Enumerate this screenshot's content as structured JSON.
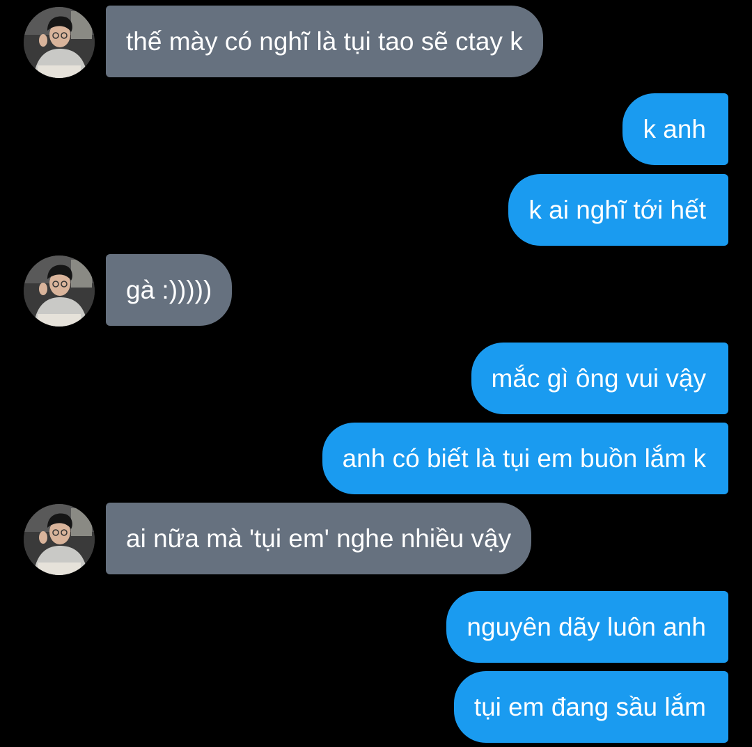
{
  "messages": [
    {
      "sender": "contact",
      "text": "thế mày có nghĩ là tụi tao sẽ ctay k"
    },
    {
      "sender": "me",
      "text": "k anh"
    },
    {
      "sender": "me",
      "text": "k ai nghĩ tới hết"
    },
    {
      "sender": "contact",
      "text": "gà :)))))"
    },
    {
      "sender": "me",
      "text": "mắc gì ông vui vậy"
    },
    {
      "sender": "me",
      "text": "anh có biết là tụi em buồn lắm k"
    },
    {
      "sender": "contact",
      "text": "ai nữa mà 'tụi em' nghe nhiều vậy"
    },
    {
      "sender": "me",
      "text": "nguyên dãy luôn anh"
    },
    {
      "sender": "me",
      "text": "tụi em đang sầu lắm"
    }
  ],
  "colors": {
    "background": "#000000",
    "incoming_bubble": "#66717f",
    "outgoing_bubble": "#1a9bf0",
    "text": "#ffffff"
  }
}
